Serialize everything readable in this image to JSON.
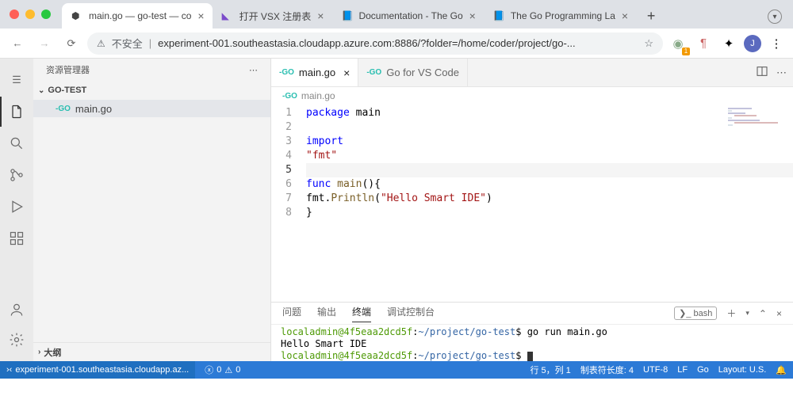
{
  "browser": {
    "tabs": [
      {
        "title": "main.go — go-test — co"
      },
      {
        "title": "打开 VSX 注册表"
      },
      {
        "title": "Documentation - The Go"
      },
      {
        "title": "The Go Programming La"
      }
    ],
    "url_prefix": "不安全",
    "url": "experiment-001.southeastasia.cloudapp.azure.com:8886/?folder=/home/coder/project/go-...",
    "avatar": "J"
  },
  "sidebar": {
    "title": "资源管理器",
    "project": "GO-TEST",
    "items": [
      {
        "name": "main.go"
      }
    ],
    "outline": "大纲"
  },
  "editor": {
    "tabs": [
      {
        "name": "main.go",
        "active": true
      },
      {
        "name": "Go for VS Code",
        "active": false
      }
    ],
    "breadcrumb": "main.go",
    "code": {
      "lines": [
        {
          "n": 1,
          "seg": [
            {
              "t": "package",
              "c": "kw"
            },
            {
              "t": " main"
            }
          ]
        },
        {
          "n": 2,
          "seg": []
        },
        {
          "n": 3,
          "seg": [
            {
              "t": "import",
              "c": "kw"
            }
          ]
        },
        {
          "n": 4,
          "seg": [
            {
              "t": "    "
            },
            {
              "t": "\"fmt\"",
              "c": "str"
            }
          ]
        },
        {
          "n": 5,
          "seg": [],
          "current": true
        },
        {
          "n": 6,
          "seg": [
            {
              "t": "func",
              "c": "kw"
            },
            {
              "t": " "
            },
            {
              "t": "main",
              "c": "fn"
            },
            {
              "t": "(){"
            }
          ]
        },
        {
          "n": 7,
          "seg": [
            {
              "t": "    fmt."
            },
            {
              "t": "Println",
              "c": "fn"
            },
            {
              "t": "("
            },
            {
              "t": "\"Hello Smart IDE\"",
              "c": "str"
            },
            {
              "t": ")"
            }
          ]
        },
        {
          "n": 8,
          "seg": [
            {
              "t": "}"
            }
          ]
        }
      ]
    }
  },
  "terminal": {
    "tabs": [
      "问题",
      "输出",
      "终端",
      "调试控制台"
    ],
    "active": 2,
    "shell": "bash",
    "prompt_user": "localadmin@4f5eaa2dcd5f",
    "prompt_path": "~/project/go-test",
    "cmd": "go run main.go",
    "output": "Hello Smart IDE"
  },
  "status": {
    "remote": "experiment-001.southeastasia.cloudapp.az...",
    "errors": "0",
    "warnings": "0",
    "position": "行 5，列 1",
    "tabsize": "制表符长度: 4",
    "encoding": "UTF-8",
    "eol": "LF",
    "lang": "Go",
    "layout": "Layout: U.S."
  }
}
